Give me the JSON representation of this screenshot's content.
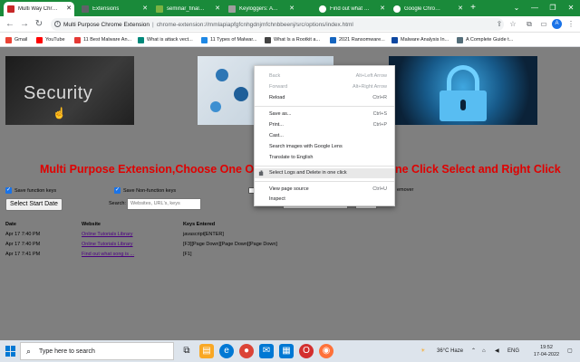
{
  "browser": {
    "tabs": [
      {
        "label": "Multi Way Chrome Ext",
        "active": true,
        "favicon_color": "#c62828"
      },
      {
        "label": "Extensions",
        "active": false,
        "favicon_color": "#5f6368"
      },
      {
        "label": "seminar_final_ - Onlin",
        "active": false,
        "favicon_color": "#7cb342"
      },
      {
        "label": "Keyloggers: A Guide",
        "active": false,
        "favicon_color": "#5f6368"
      },
      {
        "label": "Find out what song is",
        "active": false,
        "favicon_color": "#ffffff"
      },
      {
        "label": "Google Chrome Help",
        "active": false,
        "favicon_color": "#ffffff"
      }
    ],
    "address": {
      "host": "Multi Purpose Chrome Extension",
      "path": "chrome-extension://mmlapiapfgfcnhgdnjmfchnbbeenj/src/options/index.html"
    },
    "profile_initial": "A",
    "bookmarks": [
      {
        "label": "Gmail",
        "icon": "gmail-icon",
        "color": "#ea4335"
      },
      {
        "label": "YouTube",
        "icon": "youtube-icon",
        "color": "#ff0000"
      },
      {
        "label": "11 Best Malware An...",
        "icon": "page-icon",
        "color": "#e53935"
      },
      {
        "label": "What is attack vect...",
        "icon": "page-icon",
        "color": "#00897b"
      },
      {
        "label": "11 Types of Malwar...",
        "icon": "page-icon",
        "color": "#1e88e5"
      },
      {
        "label": "What Is a Rootkit a...",
        "icon": "page-icon",
        "color": "#424242"
      },
      {
        "label": "2021 Ransomware...",
        "icon": "page-icon",
        "color": "#1565c0"
      },
      {
        "label": "Malware Analysis In...",
        "icon": "page-icon",
        "color": "#0d47a1"
      },
      {
        "label": "A Complete Guide t...",
        "icon": "page-icon",
        "color": "#546e7a"
      }
    ]
  },
  "page": {
    "image_word": "Security",
    "heading_left": "Multi Purpose Extension,Choose One Or Mor",
    "heading_right": "ne Click Select and Right Click",
    "checkboxes": {
      "function_keys": "Save function keys",
      "non_function_keys": "Save Non-function keys",
      "remover": "emover"
    },
    "start_date_button": "Select Start Date",
    "search_label": "Search:",
    "search_placeholder": "Websites, URL's, keys",
    "table": {
      "headers": [
        "Date",
        "Website",
        "Keys Entered"
      ],
      "rows": [
        {
          "date": "Apr 17 7:40 PM",
          "website": "Online Tutorials Library",
          "keys": "javascript[ENTER]"
        },
        {
          "date": "Apr 17 7:40 PM",
          "website": "Online Tutorials Library",
          "keys": "[F3][Page Down][Page Down][Page Down]"
        },
        {
          "date": "Apr 17 7:41 PM",
          "website": "Find out what song is ...",
          "keys": "[F1]"
        }
      ]
    }
  },
  "context_menu": {
    "items": [
      {
        "label": "Back",
        "shortcut": "Alt+Left Arrow",
        "disabled": true
      },
      {
        "label": "Forward",
        "shortcut": "Alt+Right Arrow",
        "disabled": true
      },
      {
        "label": "Reload",
        "shortcut": "Ctrl+R",
        "disabled": false
      },
      {
        "label": "Save as...",
        "shortcut": "Ctrl+S",
        "disabled": false
      },
      {
        "label": "Print...",
        "shortcut": "Ctrl+P",
        "disabled": false
      },
      {
        "label": "Cast...",
        "shortcut": "",
        "disabled": false
      },
      {
        "label": "Search images with Google Lens",
        "shortcut": "",
        "disabled": false
      },
      {
        "label": "Translate to English",
        "shortcut": "",
        "disabled": false
      },
      {
        "label": "Select Logs and Delete in one click",
        "shortcut": "",
        "disabled": false,
        "highlighted": true
      },
      {
        "label": "View page source",
        "shortcut": "Ctrl+U",
        "disabled": false
      },
      {
        "label": "Inspect",
        "shortcut": "",
        "disabled": false
      }
    ]
  },
  "taskbar": {
    "search_placeholder": "Type here to search",
    "weather": "36°C  Haze",
    "time": "19:52",
    "date": "17-04-2022",
    "apps": [
      {
        "icon": "task-view-icon",
        "color": "#202124"
      },
      {
        "icon": "file-explorer-icon",
        "color": "#f9a825"
      },
      {
        "icon": "edge-icon",
        "color": "#0078d4"
      },
      {
        "icon": "chrome-icon",
        "color": "#db4437"
      },
      {
        "icon": "mail-icon",
        "color": "#0078d4"
      },
      {
        "icon": "store-icon",
        "color": "#0078d4"
      },
      {
        "icon": "opera-icon",
        "color": "#d32f2f"
      },
      {
        "icon": "firefox-icon",
        "color": "#ff7139"
      }
    ]
  },
  "colors": {
    "tab_strip": "#1a8a3a",
    "page_background": "#7f7f7f",
    "heading": "#e00000",
    "link": "#4b0082"
  }
}
